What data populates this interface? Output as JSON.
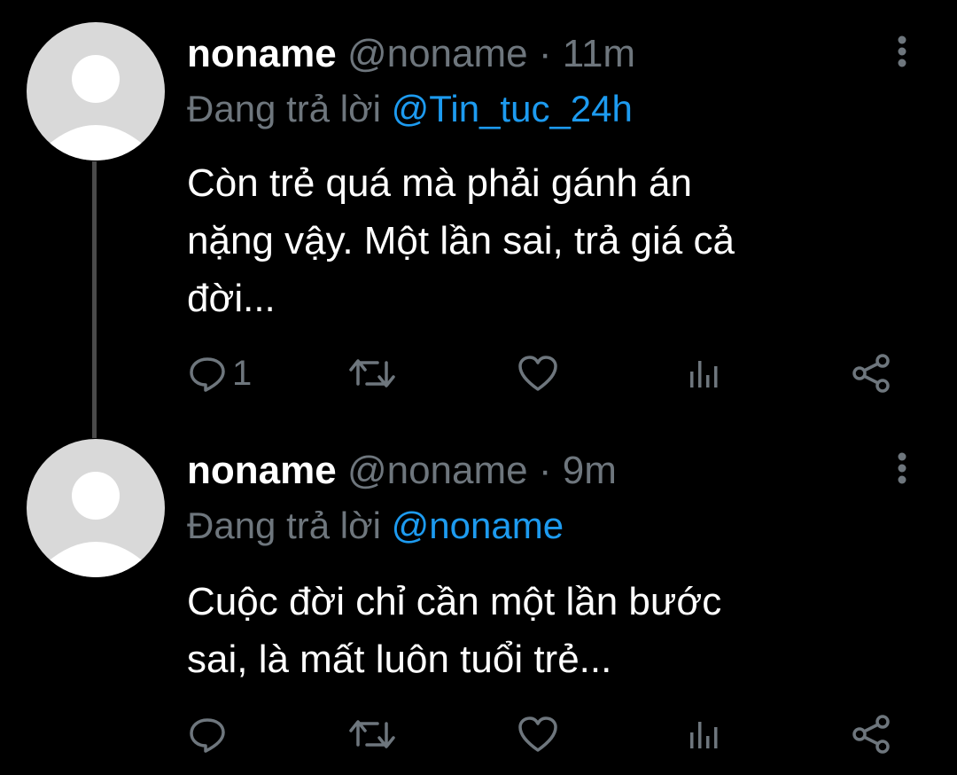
{
  "tweets": [
    {
      "name": "noname",
      "handle": "@noname",
      "separator": "·",
      "time": "11m",
      "reply_prefix": "Đang trả lời",
      "reply_to": "@Tin_tuc_24h",
      "lines": [
        "Còn trẻ quá mà phải gánh án",
        "nặng vậy. Một lần sai, trả giá cả",
        "đời..."
      ],
      "reply_count": "1",
      "icons": [
        "reply-icon",
        "retweet-icon",
        "like-icon",
        "views-icon",
        "share-icon",
        "more-icon"
      ]
    },
    {
      "name": "noname",
      "handle": "@noname",
      "separator": "·",
      "time": "9m",
      "reply_prefix": "Đang trả lời",
      "reply_to": "@noname",
      "lines": [
        "Cuộc đời chỉ cần một lần bước",
        "sai, là mất luôn tuổi trẻ..."
      ],
      "reply_count": "",
      "icons": [
        "reply-icon",
        "retweet-icon",
        "like-icon",
        "views-icon",
        "share-icon",
        "more-icon"
      ]
    }
  ],
  "colors": {
    "background": "#000000",
    "name": "#ffffff",
    "muted": "#6e767d",
    "mention": "#1d9bf0",
    "avatar": "#d9d9d9",
    "thread_line": "#4a4a4a"
  }
}
